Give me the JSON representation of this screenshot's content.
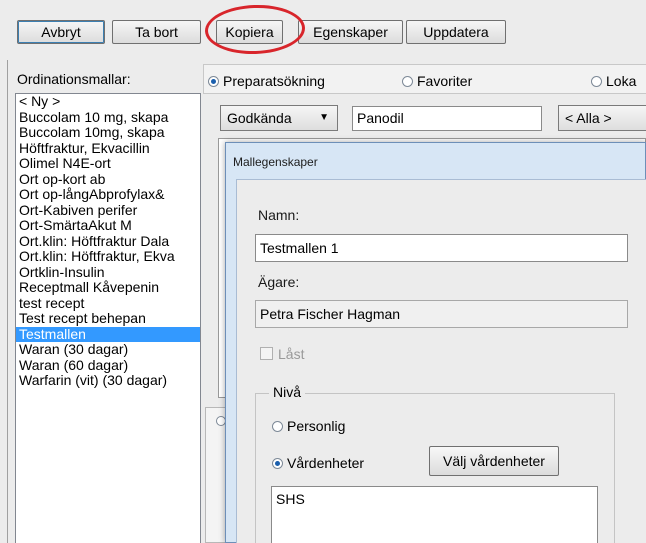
{
  "toolbar": {
    "buttons": [
      {
        "label": "Avbryt"
      },
      {
        "label": "Ta bort"
      },
      {
        "label": "Kopiera"
      },
      {
        "label": "Egenskaper"
      },
      {
        "label": "Uppdatera"
      }
    ],
    "highlight_color": "#d8252b"
  },
  "templates": {
    "label": "Ordinationsmallar:",
    "items": [
      "< Ny >",
      "Buccolam 10 mg, skapa",
      "Buccolam 10mg, skapa",
      "Höftfraktur, Ekvacillin",
      "Olimel N4E-ort",
      "Ort op-kort ab",
      "Ort op-långAbprofylax&",
      "Ort-Kabiven perifer",
      "Ort-SmärtaAkut M",
      "Ort.klin: Höftfraktur Dala",
      "Ort.klin: Höftfraktur, Ekva",
      "Ortklin-Insulin",
      "Receptmall Kåvepenin",
      "test recept",
      "Test recept behepan",
      "Testmallen",
      "Waran (30 dagar)",
      "Waran (60 dagar)",
      "Warfarin (vit) (30 dagar)"
    ],
    "selected_index": 15,
    "selection_color": "#3399ff"
  },
  "search": {
    "modes": [
      "Preparatsökning",
      "Favoriter",
      "Loka"
    ],
    "selected_mode": "Preparatsökning",
    "filter": "Godkända",
    "query": "Panodil",
    "scope": "< Alla >"
  },
  "dialog": {
    "title": "Mallegenskaper",
    "name_label": "Namn:",
    "name_value": "Testmallen 1",
    "owner_label": "Ägare:",
    "owner_value": "Petra Fischer Hagman",
    "locked_label": "Låst",
    "locked_checked": false,
    "level_group": "Nivå",
    "level_options": [
      "Personlig",
      "Vårdenheter"
    ],
    "selected_level": "Vårdenheter",
    "choose_units_button": "Välj vårdenheter",
    "units": [
      "SHS"
    ]
  }
}
